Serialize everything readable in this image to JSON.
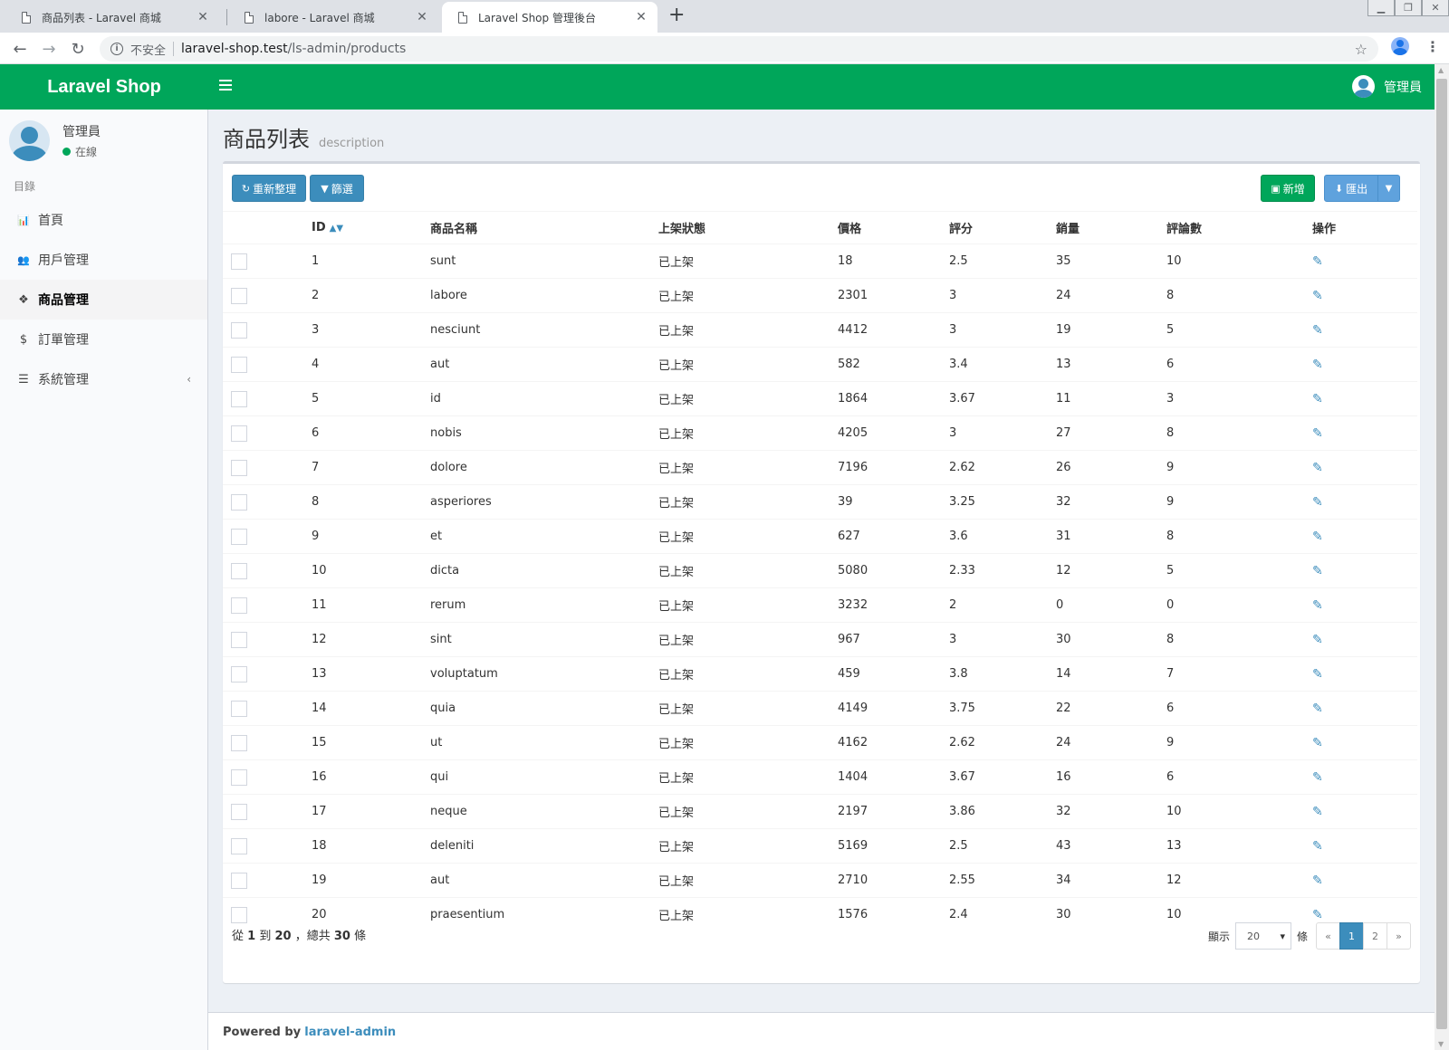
{
  "browser": {
    "tabs": [
      {
        "title": "商品列表 - Laravel 商城",
        "active": false
      },
      {
        "title": "labore - Laravel 商城",
        "active": false
      },
      {
        "title": "Laravel Shop 管理後台",
        "active": true
      }
    ],
    "new_tab": "+",
    "insecure_label": "不安全",
    "url_host": "laravel-shop.test",
    "url_path": "/ls-admin/products"
  },
  "header": {
    "logo": "Laravel Shop",
    "user": "管理員"
  },
  "sidebar": {
    "user_name": "管理員",
    "user_status": "在線",
    "menu_header": "目錄",
    "items": [
      {
        "label": "首頁",
        "icon": "bar-chart-icon",
        "glyph": "📊",
        "active": false
      },
      {
        "label": "用戶管理",
        "icon": "users-icon",
        "glyph": "👥",
        "active": false
      },
      {
        "label": "商品管理",
        "icon": "cubes-icon",
        "glyph": "❖",
        "active": true
      },
      {
        "label": "訂單管理",
        "icon": "dollar-icon",
        "glyph": "$",
        "active": false
      },
      {
        "label": "系統管理",
        "icon": "server-icon",
        "glyph": "☰",
        "active": false,
        "caret": "‹"
      }
    ]
  },
  "content": {
    "title": "商品列表",
    "description": "description"
  },
  "toolbar": {
    "refresh_label": "重新整理",
    "filter_label": "篩選",
    "new_label": "新增",
    "export_label": "匯出"
  },
  "table": {
    "columns": [
      "ID",
      "商品名稱",
      "上架狀態",
      "價格",
      "評分",
      "銷量",
      "評論數",
      "操作"
    ],
    "rows": [
      {
        "id": "1",
        "name": "sunt",
        "status": "已上架",
        "price": "18",
        "rating": "2.5",
        "sold": "35",
        "reviews": "10"
      },
      {
        "id": "2",
        "name": "labore",
        "status": "已上架",
        "price": "2301",
        "rating": "3",
        "sold": "24",
        "reviews": "8"
      },
      {
        "id": "3",
        "name": "nesciunt",
        "status": "已上架",
        "price": "4412",
        "rating": "3",
        "sold": "19",
        "reviews": "5"
      },
      {
        "id": "4",
        "name": "aut",
        "status": "已上架",
        "price": "582",
        "rating": "3.4",
        "sold": "13",
        "reviews": "6"
      },
      {
        "id": "5",
        "name": "id",
        "status": "已上架",
        "price": "1864",
        "rating": "3.67",
        "sold": "11",
        "reviews": "3"
      },
      {
        "id": "6",
        "name": "nobis",
        "status": "已上架",
        "price": "4205",
        "rating": "3",
        "sold": "27",
        "reviews": "8"
      },
      {
        "id": "7",
        "name": "dolore",
        "status": "已上架",
        "price": "7196",
        "rating": "2.62",
        "sold": "26",
        "reviews": "9"
      },
      {
        "id": "8",
        "name": "asperiores",
        "status": "已上架",
        "price": "39",
        "rating": "3.25",
        "sold": "32",
        "reviews": "9"
      },
      {
        "id": "9",
        "name": "et",
        "status": "已上架",
        "price": "627",
        "rating": "3.6",
        "sold": "31",
        "reviews": "8"
      },
      {
        "id": "10",
        "name": "dicta",
        "status": "已上架",
        "price": "5080",
        "rating": "2.33",
        "sold": "12",
        "reviews": "5"
      },
      {
        "id": "11",
        "name": "rerum",
        "status": "已上架",
        "price": "3232",
        "rating": "2",
        "sold": "0",
        "reviews": "0"
      },
      {
        "id": "12",
        "name": "sint",
        "status": "已上架",
        "price": "967",
        "rating": "3",
        "sold": "30",
        "reviews": "8"
      },
      {
        "id": "13",
        "name": "voluptatum",
        "status": "已上架",
        "price": "459",
        "rating": "3.8",
        "sold": "14",
        "reviews": "7"
      },
      {
        "id": "14",
        "name": "quia",
        "status": "已上架",
        "price": "4149",
        "rating": "3.75",
        "sold": "22",
        "reviews": "6"
      },
      {
        "id": "15",
        "name": "ut",
        "status": "已上架",
        "price": "4162",
        "rating": "2.62",
        "sold": "24",
        "reviews": "9"
      },
      {
        "id": "16",
        "name": "qui",
        "status": "已上架",
        "price": "1404",
        "rating": "3.67",
        "sold": "16",
        "reviews": "6"
      },
      {
        "id": "17",
        "name": "neque",
        "status": "已上架",
        "price": "2197",
        "rating": "3.86",
        "sold": "32",
        "reviews": "10"
      },
      {
        "id": "18",
        "name": "deleniti",
        "status": "已上架",
        "price": "5169",
        "rating": "2.5",
        "sold": "43",
        "reviews": "13"
      },
      {
        "id": "19",
        "name": "aut",
        "status": "已上架",
        "price": "2710",
        "rating": "2.55",
        "sold": "34",
        "reviews": "12"
      },
      {
        "id": "20",
        "name": "praesentium",
        "status": "已上架",
        "price": "1576",
        "rating": "2.4",
        "sold": "30",
        "reviews": "10"
      }
    ]
  },
  "footer": {
    "count_from_label": "從",
    "from": "1",
    "count_to_label": "到",
    "to": "20",
    "total_label": "，總共",
    "total": "30",
    "unit": "條",
    "show_label": "顯示",
    "per_page": "20",
    "per_page_unit": "條",
    "pages": [
      "«",
      "1",
      "2",
      "»"
    ],
    "current_page": "1"
  },
  "page_footer": {
    "powered_by": "Powered by",
    "link": "laravel-admin"
  },
  "colors": {
    "header_green": "#00a65a",
    "primary_blue": "#3c8dbc",
    "success_green": "#00a65a",
    "export_blue": "#5fa2dd"
  }
}
